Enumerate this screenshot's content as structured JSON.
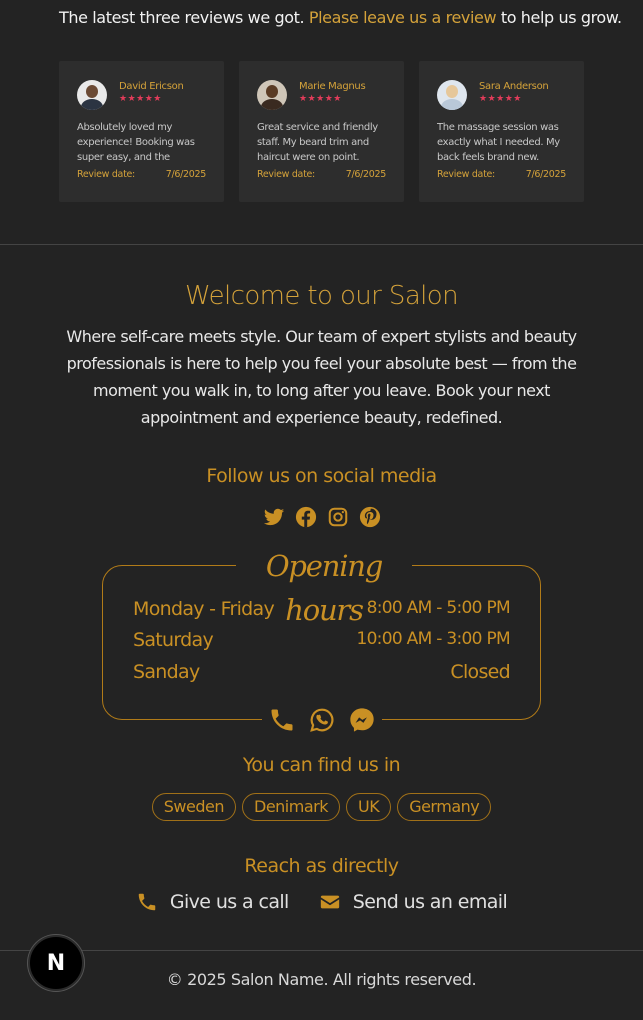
{
  "reviews_section": {
    "intro_text": "The latest three reviews we got.",
    "intro_link": "Please leave us a review",
    "intro_suffix": "to help us grow.",
    "date_label": "Review date:",
    "reviews": [
      {
        "name": "David Ericson",
        "stars": "★★★★★",
        "text": "Absolutely loved my experience! Booking was super easy, and the stylist...",
        "date": "7/6/2025"
      },
      {
        "name": "Marie Magnus",
        "stars": "★★★★★",
        "text": "Great service and friendly staff. My beard trim and haircut were on point. Only...",
        "date": "7/6/2025"
      },
      {
        "name": "Sara Anderson",
        "stars": "★★★★★",
        "text": "The massage session was exactly what I needed. My back feels brand new. Sup...",
        "date": "7/6/2025"
      }
    ]
  },
  "welcome": {
    "title": "Welcome to our Salon",
    "text": "Where self-care meets style. Our team of expert stylists and beauty professionals is here to help you feel your absolute best — from the moment you walk in, to long after you leave. Book your next appointment and experience beauty, redefined."
  },
  "social": {
    "title": "Follow us on social media",
    "icons": [
      "twitter-icon",
      "facebook-icon",
      "instagram-icon",
      "pinterest-icon"
    ]
  },
  "hours": {
    "title": "Opening hours",
    "rows": [
      {
        "day": "Monday - Friday",
        "time": "8:00 AM - 5:00 PM"
      },
      {
        "day": "Saturday",
        "time": "10:00 AM - 3:00 PM"
      },
      {
        "day": "Sanday",
        "time": "Closed"
      }
    ],
    "contact_icons": [
      "phone-icon",
      "whatsapp-icon",
      "messenger-icon"
    ]
  },
  "locations": {
    "title": "You can find us in",
    "countries": [
      "Sweden",
      "Denimark",
      "UK",
      "Germany"
    ]
  },
  "reach": {
    "title": "Reach as directly",
    "call_label": "Give us a call",
    "email_label": "Send us an email"
  },
  "footer": {
    "copyright": "© 2025 Salon Name. All rights reserved.",
    "badge_letter": "N"
  },
  "colors": {
    "background": "#232323",
    "accent": "#c99024",
    "star": "#e23c5a"
  }
}
